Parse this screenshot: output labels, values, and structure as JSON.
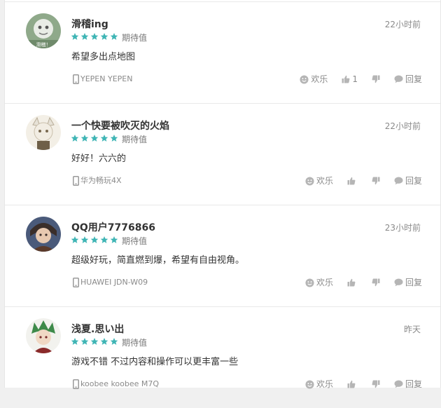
{
  "reviews": [
    {
      "username": "滑稽ing",
      "time": "22小时前",
      "rating": 5,
      "rating_label": "期待值",
      "content": "希望多出点地图",
      "device": "YEPEN YEPEN",
      "fun_label": "欢乐",
      "like_count": "1",
      "reply_label": "回复",
      "avatar_text": "滑稽！"
    },
    {
      "username": "一个快要被吹灭的火焰",
      "time": "22小时前",
      "rating": 5,
      "rating_label": "期待值",
      "content": "好好！六六的",
      "device": "华为畅玩4X",
      "fun_label": "欢乐",
      "like_count": "",
      "reply_label": "回复"
    },
    {
      "username": "QQ用户7776866",
      "time": "23小时前",
      "rating": 5,
      "rating_label": "期待值",
      "content": "超级好玩，简直燃到爆，希望有自由视角。",
      "device": "HUAWEI JDN-W09",
      "fun_label": "欢乐",
      "like_count": "",
      "reply_label": "回复"
    },
    {
      "username": "浅夏.思い出",
      "time": "昨天",
      "rating": 5,
      "rating_label": "期待值",
      "content": "游戏不错 不过内容和操作可以更丰富一些",
      "device": "koobee koobee M7Q",
      "fun_label": "欢乐",
      "like_count": "",
      "reply_label": "回复"
    }
  ],
  "icons": {
    "star": "star-icon",
    "phone": "phone-icon",
    "fun": "smile-icon",
    "like": "thumbs-up-icon",
    "dislike": "thumbs-down-icon",
    "reply": "chat-bubble-icon"
  },
  "colors": {
    "star": "#3fb5b5",
    "muted": "#8a8a8a",
    "icon": "#b5b5b5"
  }
}
